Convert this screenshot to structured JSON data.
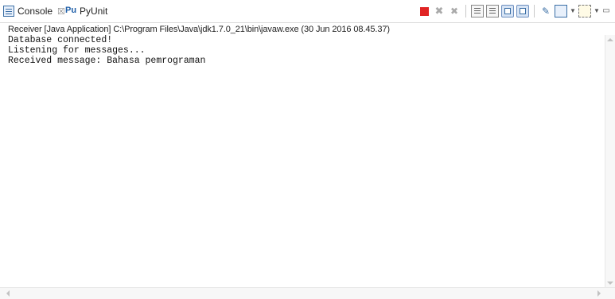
{
  "tabs": {
    "console": "Console",
    "console_close": "☒",
    "pyunit": "PyUnit",
    "pyunit_icon": "Pu"
  },
  "toolbar": {
    "icons": [
      "terminate-icon",
      "remove-launch-icon",
      "remove-all-terminated-icon",
      "clear-console-icon",
      "scroll-lock-icon",
      "word-wrap-icon",
      "show-console-on-output-icon",
      "pin-console-icon",
      "display-selected-console-icon",
      "open-console-icon",
      "minimize-icon"
    ],
    "terminate_color": "#e02424"
  },
  "header": {
    "process": "Receiver [Java Application] C:\\Program Files\\Java\\jdk1.7.0_21\\bin\\javaw.exe (30 Jun 2016 08.45.37)"
  },
  "output": {
    "lines": [
      "Database connected!",
      "Listening for messages...",
      "Received message: Bahasa pemrograman"
    ]
  }
}
